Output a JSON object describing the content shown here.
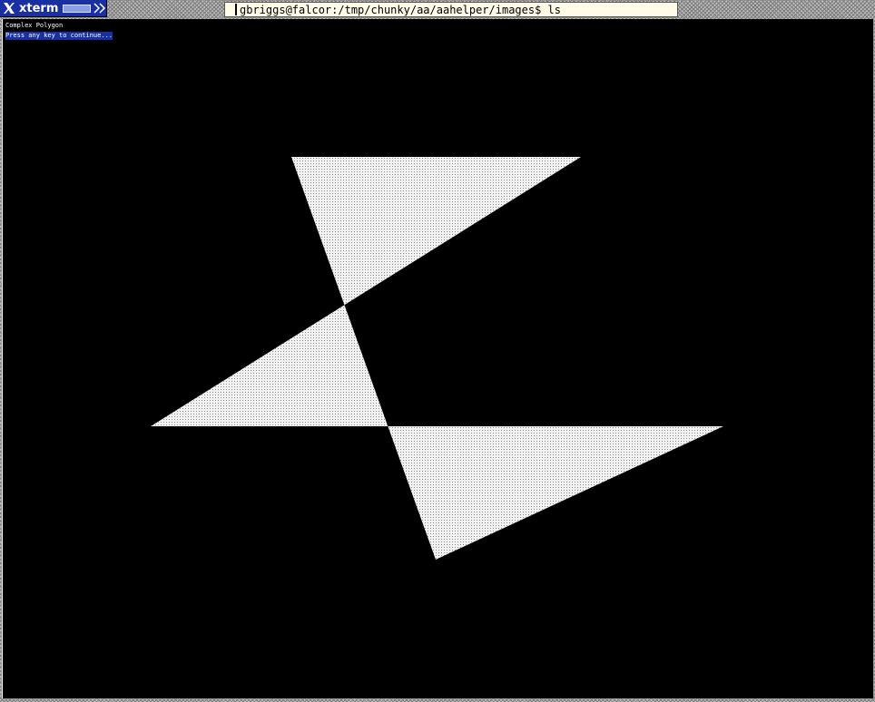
{
  "window": {
    "title": "xterm",
    "command_line": "gbriggs@falcor:/tmp/chunky/aa/aahelper/images$ ls"
  },
  "icons": {
    "logo": "x-logo-icon",
    "expand": "double-chevron-right-icon"
  },
  "terminal": {
    "lines": [
      "Complex Polygon",
      "Press any key to continue..."
    ]
  },
  "colors": {
    "terminal_background": "#000000",
    "polygon_fill": "#ffffff",
    "title_tab": "#1a2fa0",
    "command_field": "#fffbe6"
  }
}
